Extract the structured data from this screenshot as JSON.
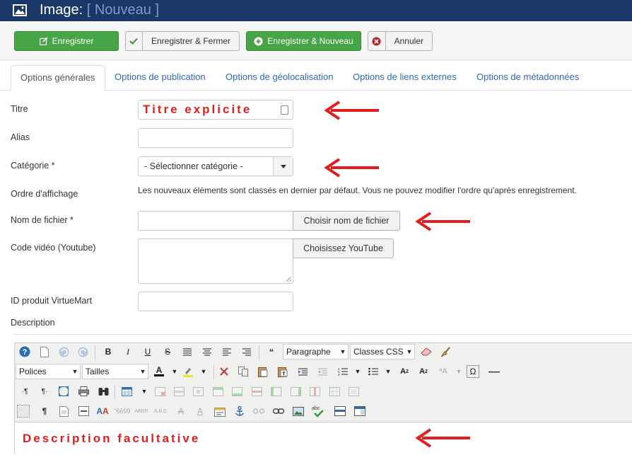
{
  "header": {
    "title": "Image:",
    "subtitle": "[ Nouveau ]"
  },
  "toolbar": {
    "save_label": "Enregistrer",
    "save_close_label": "Enregistrer & Fermer",
    "save_new_label": "Enregistrer & Nouveau",
    "cancel_label": "Annuler"
  },
  "tabs": [
    {
      "label": "Options générales",
      "active": true
    },
    {
      "label": "Options de publication"
    },
    {
      "label": "Options de géolocalisation"
    },
    {
      "label": "Options de liens externes"
    },
    {
      "label": "Options de métadonnées"
    }
  ],
  "form": {
    "title_label": "Titre",
    "title_value": "Titre explicite",
    "alias_label": "Alias",
    "alias_value": "",
    "category_label": "Catégorie *",
    "category_value": "- Sélectionner catégorie -",
    "order_label": "Ordre d'affichage",
    "order_hint": "Les nouveaux éléments sont classés en dernier par défaut. Vous ne pouvez modifier l'ordre qu'après enregistrement.",
    "filename_label": "Nom de fichier *",
    "filename_value": "",
    "filename_button": "Choisir nom de fichier",
    "video_label": "Code vidéo (Youtube)",
    "video_value": "",
    "video_button": "Choisissez YouTube",
    "virtuemart_label": "ID produit VirtueMart",
    "virtuemart_value": "",
    "description_label": "Description"
  },
  "editor": {
    "format_select": "Paragraphe",
    "classes_select": "Classes CSS",
    "font_select": "Polices",
    "size_select": "Tailles",
    "content": "Description facultative"
  },
  "colors": {
    "header_bg": "#1a3867",
    "green": "#46a546",
    "link": "#2a69b8",
    "annotation_red": "#e01e1e"
  }
}
